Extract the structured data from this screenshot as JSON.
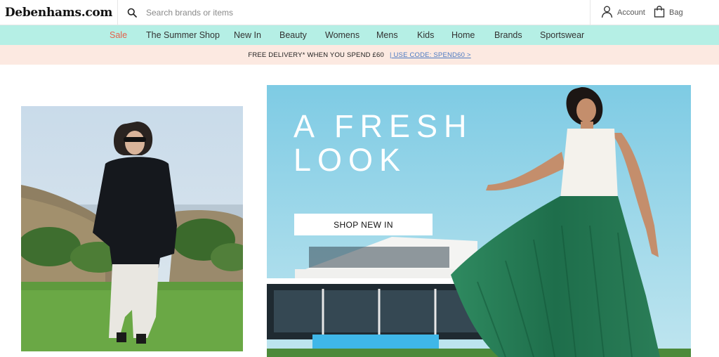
{
  "header": {
    "logo": "Debenhams.com",
    "search_placeholder": "Search brands or items",
    "account_label": "Account",
    "bag_label": "Bag"
  },
  "nav": {
    "items": [
      "Sale",
      "The Summer Shop",
      "New In",
      "Beauty",
      "Womens",
      "Mens",
      "Kids",
      "Home",
      "Brands",
      "Sportswear"
    ]
  },
  "promo": {
    "text": "FREE DELIVERY* WHEN YOU SPEND £60",
    "code": "| USE CODE: SPEND60 >"
  },
  "hero": {
    "title_line1": "A FRESH",
    "title_line2": "LOOK",
    "button_label": "SHOP NEW IN"
  },
  "colors": {
    "nav_bg": "#b5efe5",
    "promo_bg": "#fce9e1",
    "sale": "#e4604c",
    "link": "#4a79c2"
  }
}
